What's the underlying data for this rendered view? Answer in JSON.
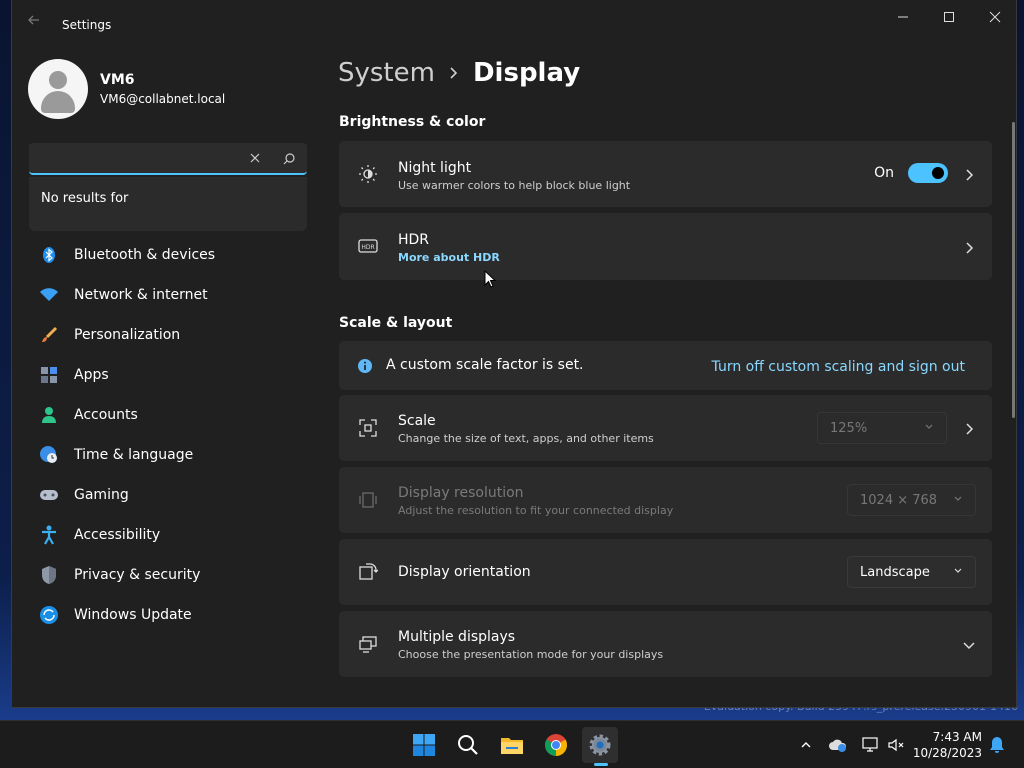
{
  "window": {
    "title": "Settings",
    "back_icon": "back-arrow-icon"
  },
  "profile": {
    "name": "VM6",
    "email": "VM6@collabnet.local"
  },
  "search": {
    "value": "",
    "placeholder": "",
    "popup_text": "No results for"
  },
  "sidebar": {
    "items": [
      {
        "label": "Bluetooth & devices",
        "icon": "bluetooth-icon"
      },
      {
        "label": "Network & internet",
        "icon": "wifi-icon"
      },
      {
        "label": "Personalization",
        "icon": "paintbrush-icon"
      },
      {
        "label": "Apps",
        "icon": "apps-icon"
      },
      {
        "label": "Accounts",
        "icon": "account-icon"
      },
      {
        "label": "Time & language",
        "icon": "clock-globe-icon"
      },
      {
        "label": "Gaming",
        "icon": "gamepad-icon"
      },
      {
        "label": "Accessibility",
        "icon": "accessibility-icon"
      },
      {
        "label": "Privacy & security",
        "icon": "shield-icon"
      },
      {
        "label": "Windows Update",
        "icon": "update-icon"
      }
    ]
  },
  "breadcrumb": {
    "parent": "System",
    "current": "Display"
  },
  "brightness_section": {
    "title": "Brightness & color",
    "night_light": {
      "title": "Night light",
      "subtitle": "Use warmer colors to help block blue light",
      "state_label": "On",
      "enabled": true
    },
    "hdr": {
      "title": "HDR",
      "link": "More about HDR"
    }
  },
  "scale_section": {
    "title": "Scale & layout",
    "info": {
      "text": "A custom scale factor is set.",
      "link": "Turn off custom scaling and sign out"
    },
    "scale": {
      "title": "Scale",
      "subtitle": "Change the size of text, apps, and other items",
      "value": "125%"
    },
    "resolution": {
      "title": "Display resolution",
      "subtitle": "Adjust the resolution to fit your connected display",
      "value": "1024 × 768"
    },
    "orientation": {
      "title": "Display orientation",
      "value": "Landscape"
    },
    "multiple_displays": {
      "title": "Multiple displays",
      "subtitle": "Choose the presentation mode for your displays"
    }
  },
  "watermark": "Evaluation copy. Build 25947.rs_prerelease.230901-1416",
  "taskbar": {
    "apps": [
      "start-icon",
      "search-icon",
      "file-explorer-icon",
      "chrome-icon",
      "settings-icon"
    ],
    "time": "7:43 AM",
    "date": "10/28/2023"
  },
  "colors": {
    "accent": "#4cc2ff",
    "link": "#8ad7ff",
    "card": "#2b2b2b",
    "window_bg": "#202020"
  }
}
